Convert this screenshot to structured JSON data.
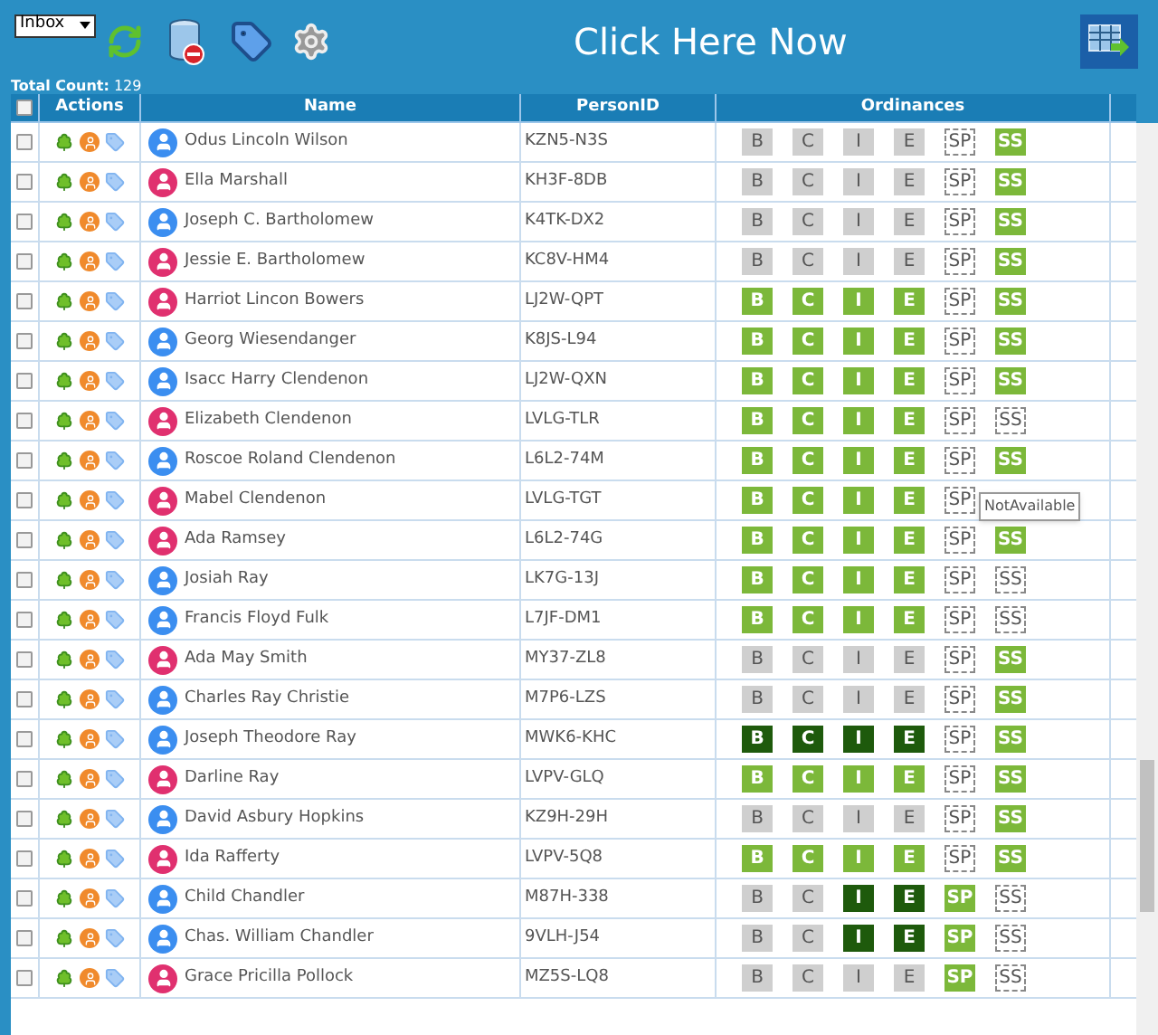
{
  "toolbar": {
    "folder_select": "Inbox",
    "banner": "Click Here Now"
  },
  "total_count": "**Total Count:** 129",
  "table": {
    "columns": [
      "Actions",
      "Name",
      "PersonID",
      "Ordinances"
    ],
    "select_all_checked": false,
    "rows": [
      {
        "checked": false,
        "color": "#3b8ef0",
        "name": "Odus Lincoln Wilson",
        "person_id": "KZN5-N3S",
        "ordinances": [
          {
            "label": "B",
            "kind": "pending"
          },
          {
            "label": "C",
            "kind": "pending"
          },
          {
            "label": "I",
            "kind": "pending"
          },
          {
            "label": "E",
            "kind": "pending"
          },
          {
            "label": "SP",
            "kind": "unavailable"
          },
          {
            "label": "SS",
            "kind": "ready"
          }
        ]
      },
      {
        "checked": false,
        "color": "#e0306f",
        "name": "Ella Marshall",
        "person_id": "KH3F-8DB",
        "ordinances": [
          {
            "label": "B",
            "kind": "pending"
          },
          {
            "label": "C",
            "kind": "pending"
          },
          {
            "label": "I",
            "kind": "pending"
          },
          {
            "label": "E",
            "kind": "pending"
          },
          {
            "label": "SP",
            "kind": "unavailable"
          },
          {
            "label": "SS",
            "kind": "ready"
          }
        ]
      },
      {
        "checked": false,
        "color": "#3b8ef0",
        "name": "Joseph C. Bartholomew",
        "person_id": "K4TK-DX2",
        "ordinances": [
          {
            "label": "B",
            "kind": "pending"
          },
          {
            "label": "C",
            "kind": "pending"
          },
          {
            "label": "I",
            "kind": "pending"
          },
          {
            "label": "E",
            "kind": "pending"
          },
          {
            "label": "SP",
            "kind": "unavailable"
          },
          {
            "label": "SS",
            "kind": "ready"
          }
        ]
      },
      {
        "checked": false,
        "color": "#e0306f",
        "name": "Jessie E. Bartholomew",
        "person_id": "KC8V-HM4",
        "ordinances": [
          {
            "label": "B",
            "kind": "pending"
          },
          {
            "label": "C",
            "kind": "pending"
          },
          {
            "label": "I",
            "kind": "pending"
          },
          {
            "label": "E",
            "kind": "pending"
          },
          {
            "label": "SP",
            "kind": "unavailable"
          },
          {
            "label": "SS",
            "kind": "ready"
          }
        ]
      },
      {
        "checked": false,
        "color": "#e0306f",
        "name": "Harriot Lincon Bowers",
        "person_id": "LJ2W-QPT",
        "ordinances": [
          {
            "label": "B",
            "kind": "ready"
          },
          {
            "label": "C",
            "kind": "ready"
          },
          {
            "label": "I",
            "kind": "ready"
          },
          {
            "label": "E",
            "kind": "ready"
          },
          {
            "label": "SP",
            "kind": "unavailable"
          },
          {
            "label": "SS",
            "kind": "ready"
          }
        ]
      },
      {
        "checked": false,
        "color": "#3b8ef0",
        "name": "Georg Wiesendanger",
        "person_id": "K8JS-L94",
        "ordinances": [
          {
            "label": "B",
            "kind": "ready"
          },
          {
            "label": "C",
            "kind": "ready"
          },
          {
            "label": "I",
            "kind": "ready"
          },
          {
            "label": "E",
            "kind": "ready"
          },
          {
            "label": "SP",
            "kind": "unavailable"
          },
          {
            "label": "SS",
            "kind": "ready"
          }
        ]
      },
      {
        "checked": false,
        "color": "#3b8ef0",
        "name": "Isacc Harry Clendenon",
        "person_id": "LJ2W-QXN",
        "ordinances": [
          {
            "label": "B",
            "kind": "ready"
          },
          {
            "label": "C",
            "kind": "ready"
          },
          {
            "label": "I",
            "kind": "ready"
          },
          {
            "label": "E",
            "kind": "ready"
          },
          {
            "label": "SP",
            "kind": "unavailable"
          },
          {
            "label": "SS",
            "kind": "ready"
          }
        ]
      },
      {
        "checked": false,
        "color": "#e0306f",
        "name": "Elizabeth Clendenon",
        "person_id": "LVLG-TLR",
        "ordinances": [
          {
            "label": "B",
            "kind": "ready"
          },
          {
            "label": "C",
            "kind": "ready"
          },
          {
            "label": "I",
            "kind": "ready"
          },
          {
            "label": "E",
            "kind": "ready"
          },
          {
            "label": "SP",
            "kind": "unavailable"
          },
          {
            "label": "SS",
            "kind": "unavailable"
          }
        ]
      },
      {
        "checked": false,
        "color": "#3b8ef0",
        "name": "Roscoe Roland Clendenon",
        "person_id": "L6L2-74M",
        "ordinances": [
          {
            "label": "B",
            "kind": "ready"
          },
          {
            "label": "C",
            "kind": "ready"
          },
          {
            "label": "I",
            "kind": "ready"
          },
          {
            "label": "E",
            "kind": "ready"
          },
          {
            "label": "SP",
            "kind": "unavailable"
          },
          {
            "label": "SS",
            "kind": "ready"
          }
        ]
      },
      {
        "checked": false,
        "color": "#e0306f",
        "name": "Mabel Clendenon",
        "person_id": "LVLG-TGT",
        "ordinances": [
          {
            "label": "B",
            "kind": "ready"
          },
          {
            "label": "C",
            "kind": "ready"
          },
          {
            "label": "I",
            "kind": "ready"
          },
          {
            "label": "E",
            "kind": "ready"
          },
          {
            "label": "SP",
            "kind": "unavailable",
            "tooltip": "NotAvailable"
          }
        ]
      },
      {
        "checked": false,
        "color": "#e0306f",
        "name": "Ada Ramsey",
        "person_id": "L6L2-74G",
        "ordinances": [
          {
            "label": "B",
            "kind": "ready"
          },
          {
            "label": "C",
            "kind": "ready"
          },
          {
            "label": "I",
            "kind": "ready"
          },
          {
            "label": "E",
            "kind": "ready"
          },
          {
            "label": "SP",
            "kind": "unavailable"
          },
          {
            "label": "SS",
            "kind": "ready"
          }
        ]
      },
      {
        "checked": false,
        "color": "#3b8ef0",
        "name": "Josiah Ray",
        "person_id": "LK7G-13J",
        "ordinances": [
          {
            "label": "B",
            "kind": "ready"
          },
          {
            "label": "C",
            "kind": "ready"
          },
          {
            "label": "I",
            "kind": "ready"
          },
          {
            "label": "E",
            "kind": "ready"
          },
          {
            "label": "SP",
            "kind": "unavailable"
          },
          {
            "label": "SS",
            "kind": "unavailable"
          }
        ]
      },
      {
        "checked": false,
        "color": "#3b8ef0",
        "name": "Francis Floyd Fulk",
        "person_id": "L7JF-DM1",
        "ordinances": [
          {
            "label": "B",
            "kind": "ready"
          },
          {
            "label": "C",
            "kind": "ready"
          },
          {
            "label": "I",
            "kind": "ready"
          },
          {
            "label": "E",
            "kind": "ready"
          },
          {
            "label": "SP",
            "kind": "unavailable"
          },
          {
            "label": "SS",
            "kind": "unavailable"
          }
        ]
      },
      {
        "checked": false,
        "color": "#e0306f",
        "name": "Ada May Smith",
        "person_id": "MY37-ZL8",
        "ordinances": [
          {
            "label": "B",
            "kind": "pending"
          },
          {
            "label": "C",
            "kind": "pending"
          },
          {
            "label": "I",
            "kind": "pending"
          },
          {
            "label": "E",
            "kind": "pending"
          },
          {
            "label": "SP",
            "kind": "unavailable"
          },
          {
            "label": "SS",
            "kind": "ready"
          }
        ]
      },
      {
        "checked": false,
        "color": "#3b8ef0",
        "name": "Charles Ray Christie",
        "person_id": "M7P6-LZS",
        "ordinances": [
          {
            "label": "B",
            "kind": "pending"
          },
          {
            "label": "C",
            "kind": "pending"
          },
          {
            "label": "I",
            "kind": "pending"
          },
          {
            "label": "E",
            "kind": "pending"
          },
          {
            "label": "SP",
            "kind": "unavailable"
          },
          {
            "label": "SS",
            "kind": "ready"
          }
        ]
      },
      {
        "checked": false,
        "color": "#3b8ef0",
        "name": "Joseph Theodore Ray",
        "person_id": "MWK6-KHC",
        "ordinances": [
          {
            "label": "B",
            "kind": "done"
          },
          {
            "label": "C",
            "kind": "done"
          },
          {
            "label": "I",
            "kind": "done"
          },
          {
            "label": "E",
            "kind": "done"
          },
          {
            "label": "SP",
            "kind": "unavailable"
          },
          {
            "label": "SS",
            "kind": "ready"
          }
        ]
      },
      {
        "checked": false,
        "color": "#e0306f",
        "name": "Darline Ray",
        "person_id": "LVPV-GLQ",
        "ordinances": [
          {
            "label": "B",
            "kind": "ready"
          },
          {
            "label": "C",
            "kind": "ready"
          },
          {
            "label": "I",
            "kind": "ready"
          },
          {
            "label": "E",
            "kind": "ready"
          },
          {
            "label": "SP",
            "kind": "unavailable"
          },
          {
            "label": "SS",
            "kind": "ready"
          }
        ]
      },
      {
        "checked": false,
        "color": "#3b8ef0",
        "name": "David Asbury Hopkins",
        "person_id": "KZ9H-29H",
        "ordinances": [
          {
            "label": "B",
            "kind": "pending"
          },
          {
            "label": "C",
            "kind": "pending"
          },
          {
            "label": "I",
            "kind": "pending"
          },
          {
            "label": "E",
            "kind": "pending"
          },
          {
            "label": "SP",
            "kind": "unavailable"
          },
          {
            "label": "SS",
            "kind": "ready"
          }
        ]
      },
      {
        "checked": false,
        "color": "#e0306f",
        "name": "Ida Rafferty",
        "person_id": "LVPV-5Q8",
        "ordinances": [
          {
            "label": "B",
            "kind": "ready"
          },
          {
            "label": "C",
            "kind": "ready"
          },
          {
            "label": "I",
            "kind": "ready"
          },
          {
            "label": "E",
            "kind": "ready"
          },
          {
            "label": "SP",
            "kind": "unavailable"
          },
          {
            "label": "SS",
            "kind": "ready"
          }
        ]
      },
      {
        "checked": false,
        "color": "#3b8ef0",
        "name": "Child Chandler",
        "person_id": "M87H-338",
        "ordinances": [
          {
            "label": "B",
            "kind": "pending"
          },
          {
            "label": "C",
            "kind": "pending"
          },
          {
            "label": "I",
            "kind": "done"
          },
          {
            "label": "E",
            "kind": "done"
          },
          {
            "label": "SP",
            "kind": "ready"
          },
          {
            "label": "SS",
            "kind": "unavailable"
          }
        ]
      },
      {
        "checked": false,
        "color": "#3b8ef0",
        "name": "Chas. William Chandler",
        "person_id": "9VLH-J54",
        "ordinances": [
          {
            "label": "B",
            "kind": "pending"
          },
          {
            "label": "C",
            "kind": "pending"
          },
          {
            "label": "I",
            "kind": "done"
          },
          {
            "label": "E",
            "kind": "done"
          },
          {
            "label": "SP",
            "kind": "ready"
          },
          {
            "label": "SS",
            "kind": "unavailable"
          }
        ]
      },
      {
        "checked": false,
        "color": "#e0306f",
        "name": "Grace Pricilla Pollock",
        "person_id": "MZ5S-LQ8",
        "ordinances": [
          {
            "label": "B",
            "kind": "pending"
          },
          {
            "label": "C",
            "kind": "pending"
          },
          {
            "label": "I",
            "kind": "pending"
          },
          {
            "label": "E",
            "kind": "pending"
          },
          {
            "label": "SP",
            "kind": "ready"
          },
          {
            "label": "SS",
            "kind": "unavailable"
          }
        ]
      }
    ]
  }
}
